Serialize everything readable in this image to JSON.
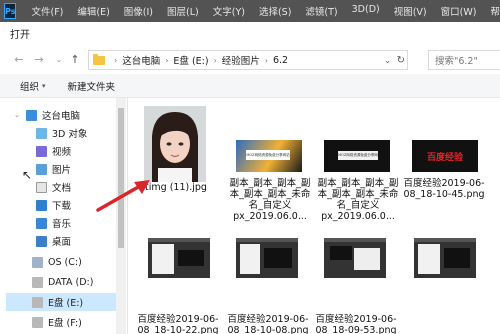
{
  "ps_menubar": {
    "logo": "Ps",
    "menus": [
      "文件(F)",
      "编辑(E)",
      "图像(I)",
      "图层(L)",
      "文字(Y)",
      "选择(S)",
      "滤镜(T)",
      "3D(D)",
      "视图(V)",
      "窗口(W)",
      "帮助(H)"
    ]
  },
  "dialog": {
    "title": "打开"
  },
  "address": {
    "crumbs": [
      "这台电脑",
      "E盘 (E:)",
      "经验图片",
      "6.2"
    ],
    "search_placeholder": "搜索\"6.2\""
  },
  "toolbar": {
    "organize": "组织",
    "new_folder": "新建文件夹"
  },
  "sidebar": {
    "items": [
      {
        "label": "这台电脑",
        "icon": "computer-icon"
      },
      {
        "label": "3D 对象",
        "icon": "3d-objects-icon"
      },
      {
        "label": "视频",
        "icon": "video-icon"
      },
      {
        "label": "图片",
        "icon": "pictures-icon"
      },
      {
        "label": "文档",
        "icon": "documents-icon"
      },
      {
        "label": "下载",
        "icon": "download-icon"
      },
      {
        "label": "音乐",
        "icon": "music-icon"
      },
      {
        "label": "桌面",
        "icon": "desktop-icon"
      },
      {
        "label": "OS (C:)",
        "icon": "drive-icon"
      },
      {
        "label": "DATA (D:)",
        "icon": "drive-icon"
      },
      {
        "label": "E盘 (E:)",
        "icon": "drive-icon"
      },
      {
        "label": "E盘 (F:)",
        "icon": "drive-icon"
      }
    ]
  },
  "files": [
    {
      "name": "timg (11).jpg",
      "type": "photo"
    },
    {
      "name": "副本_副本_副本_副本_副本_副本_未命名_自定义px_2019.06.0...",
      "type": "banner"
    },
    {
      "name": "副本_副本_副本_副本_副本_副本_未命名_自定义px_2019.06.0...",
      "type": "dark-banner"
    },
    {
      "name": "百度经验2019-06-08_18-10-45.png",
      "type": "red-text"
    },
    {
      "name": "百度经验2019-06-08_18-10-22.png",
      "type": "ps-window"
    },
    {
      "name": "百度经验2019-06-08_18-10-08.png",
      "type": "ps-window"
    },
    {
      "name": "百度经验2019-06-08_18-09-53.png",
      "type": "ps-window"
    },
    {
      "name": "",
      "type": "ps-window"
    }
  ],
  "banner_text": "MOZ网络资源免费分享网站",
  "dark_banner_text": "MOZ网络资源免费分享网站",
  "red_text_thumb": "百度经验",
  "colors": {
    "ps_bar": "#535353",
    "selection": "#cce8ff",
    "arrow": "#d9262c",
    "folder": "#f4c542"
  }
}
